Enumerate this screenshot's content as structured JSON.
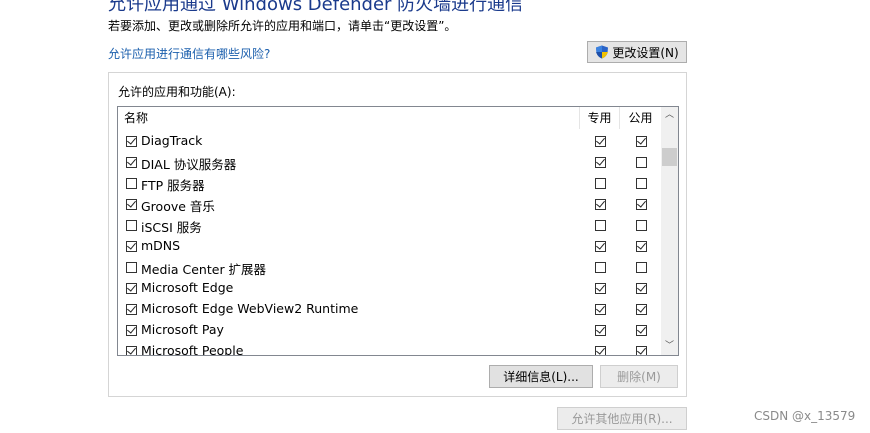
{
  "header": {
    "title": "允许应用通过 Windows Defender 防火墙进行通信",
    "description": "若要添加、更改或删除所允许的应用和端口，请单击“更改设置”。",
    "risk_link": "允许应用进行通信有哪些风险?",
    "change_settings_label": "更改设置(N)"
  },
  "group": {
    "label": "允许的应用和功能(A):",
    "columns": {
      "name": "名称",
      "private": "专用",
      "public": "公用"
    }
  },
  "apps": [
    {
      "name": "DiagTrack",
      "enabled": true,
      "private": true,
      "public": true
    },
    {
      "name": "DIAL 协议服务器",
      "enabled": true,
      "private": true,
      "public": false
    },
    {
      "name": "FTP 服务器",
      "enabled": false,
      "private": false,
      "public": false
    },
    {
      "name": "Groove 音乐",
      "enabled": true,
      "private": true,
      "public": true
    },
    {
      "name": "iSCSI 服务",
      "enabled": false,
      "private": false,
      "public": false
    },
    {
      "name": "mDNS",
      "enabled": true,
      "private": true,
      "public": true
    },
    {
      "name": "Media Center 扩展器",
      "enabled": false,
      "private": false,
      "public": false
    },
    {
      "name": "Microsoft Edge",
      "enabled": true,
      "private": true,
      "public": true
    },
    {
      "name": "Microsoft Edge WebView2 Runtime",
      "enabled": true,
      "private": true,
      "public": true
    },
    {
      "name": "Microsoft Pay",
      "enabled": true,
      "private": true,
      "public": true
    },
    {
      "name": "Microsoft People",
      "enabled": true,
      "private": true,
      "public": true
    }
  ],
  "buttons": {
    "details": "详细信息(L)...",
    "remove": "删除(M)",
    "allow_other": "允许其他应用(R)..."
  },
  "watermark": "CSDN @x_13579",
  "icons": {
    "change_settings": "uac-shield-icon",
    "scroll_up": "chevron-up-icon",
    "scroll_down": "chevron-down-icon"
  }
}
